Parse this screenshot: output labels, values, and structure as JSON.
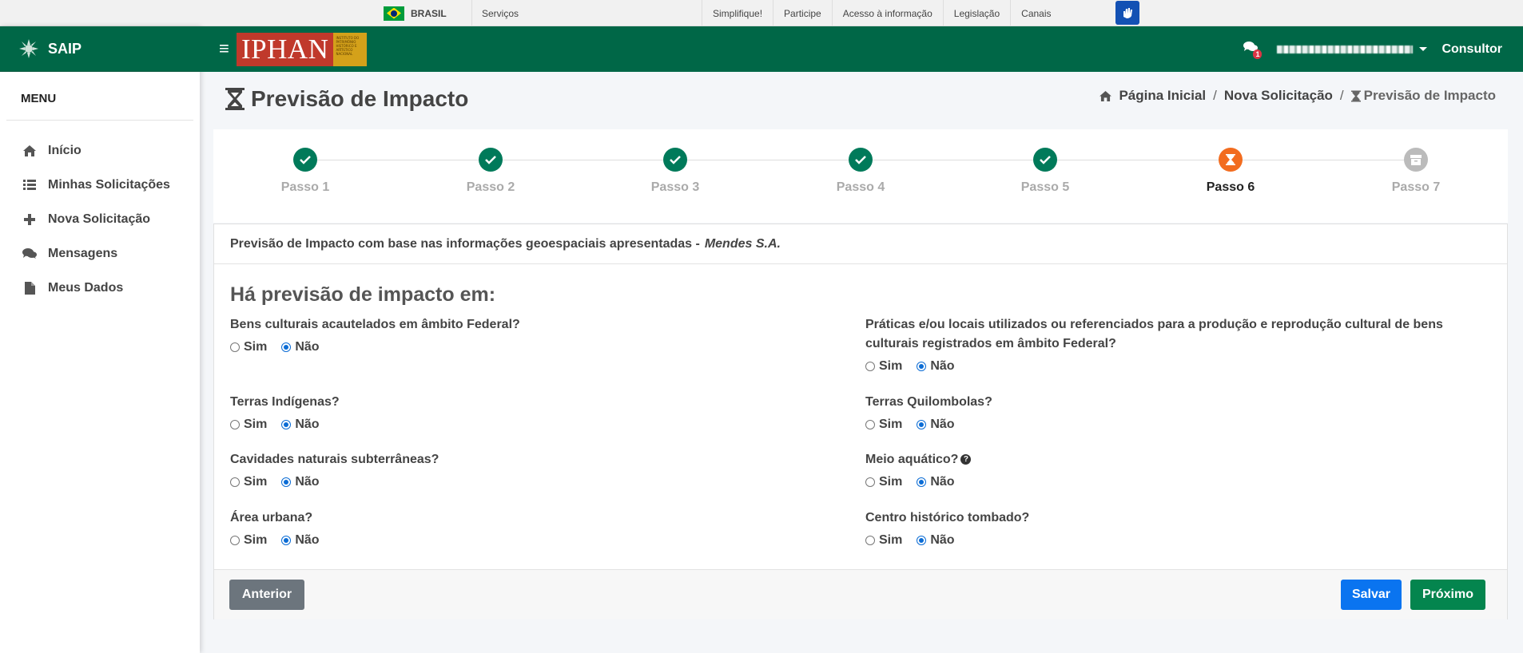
{
  "govbar": {
    "country": "BRASIL",
    "services": "Serviços",
    "links": [
      "Simplifique!",
      "Participe",
      "Acesso à informação",
      "Legislação",
      "Canais"
    ]
  },
  "sidebar": {
    "brand": "SAIP",
    "menu_title": "MENU",
    "items": [
      {
        "label": "Início",
        "icon": "home-icon"
      },
      {
        "label": "Minhas Solicitações",
        "icon": "list-icon"
      },
      {
        "label": "Nova Solicitação",
        "icon": "plus-icon"
      },
      {
        "label": "Mensagens",
        "icon": "chat-icon"
      },
      {
        "label": "Meus Dados",
        "icon": "file-icon"
      }
    ]
  },
  "header": {
    "logo_text": "IPHAN",
    "logo_subtext": "INSTITUTO DO PATRIMÔNIO HISTÓRICO E ARTÍSTICO NACIONAL",
    "messages_count": "1",
    "role": "Consultor"
  },
  "page": {
    "title": "Previsão de Impacto",
    "breadcrumb": [
      "Página Inicial",
      "Nova Solicitação",
      "Previsão de Impacto"
    ]
  },
  "steps": {
    "items": [
      "Passo 1",
      "Passo 2",
      "Passo 3",
      "Passo 4",
      "Passo 5",
      "Passo 6",
      "Passo 7"
    ],
    "states": [
      "done",
      "done",
      "done",
      "done",
      "done",
      "active",
      "pending"
    ]
  },
  "form": {
    "header_text": "Previsão de Impacto com base nas informações geoespaciais apresentadas -",
    "company": "Mendes S.A.",
    "section_title": "Há previsão de impacto em:",
    "yes_label": "Sim",
    "no_label": "Não",
    "questions": [
      {
        "text": "Bens culturais acautelados em âmbito Federal?",
        "value": "Não"
      },
      {
        "text": "Práticas e/ou locais utilizados ou referenciados para a produção e reprodução cultural de bens culturais registrados em âmbito Federal?",
        "value": "Não"
      },
      {
        "text": "Terras Indígenas?",
        "value": "Não"
      },
      {
        "text": "Terras Quilombolas?",
        "value": "Não"
      },
      {
        "text": "Cavidades naturais subterrâneas?",
        "value": "Não"
      },
      {
        "text": "Meio aquático?",
        "value": "Não"
      },
      {
        "text": "Área urbana?",
        "value": "Não"
      },
      {
        "text": "Centro histórico tombado?",
        "value": "Não"
      }
    ]
  },
  "footer": {
    "prev_label": "Anterior",
    "save_label": "Salvar",
    "next_label": "Próximo"
  },
  "colors": {
    "brand_green": "#006747",
    "step_done": "#007a5a",
    "step_active": "#f26c1f",
    "save_blue": "#0a74f0",
    "next_green": "#04854e"
  }
}
